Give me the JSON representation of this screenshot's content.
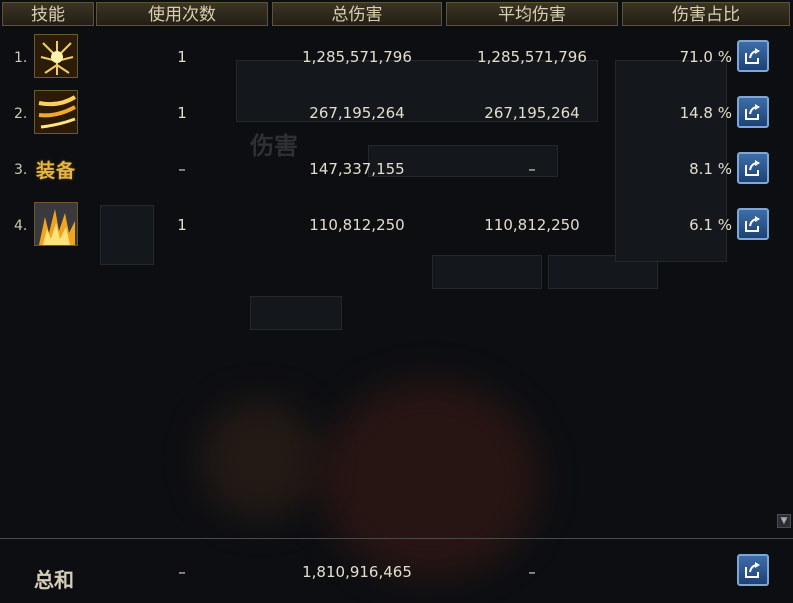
{
  "header": {
    "skill": "技能",
    "uses": "使用次数",
    "total": "总伤害",
    "avg": "平均伤害",
    "pct": "伤害占比"
  },
  "rows": [
    {
      "index": "1.",
      "icon": "golden-burst-skill-icon",
      "uses": "1",
      "total": "1,285,571,796",
      "avg": "1,285,571,796",
      "pct": "71.0 %"
    },
    {
      "index": "2.",
      "icon": "golden-slash-skill-icon",
      "uses": "1",
      "total": "267,195,264",
      "avg": "267,195,264",
      "pct": "14.8 %"
    },
    {
      "index": "3.",
      "icon": "equipment-text-icon",
      "icon_text": "装备",
      "uses": "–",
      "total": "147,337,155",
      "avg": "–",
      "pct": "8.1 %"
    },
    {
      "index": "4.",
      "icon": "golden-flames-skill-icon",
      "uses": "1",
      "total": "110,812,250",
      "avg": "110,812,250",
      "pct": "6.1 %"
    }
  ],
  "footer": {
    "label": "总和",
    "uses": "–",
    "total": "1,810,916,465",
    "avg": "–"
  },
  "colors": {
    "header_bg": "#3b3524",
    "share_button": "#3e6da8",
    "gold": "#e2b548"
  }
}
